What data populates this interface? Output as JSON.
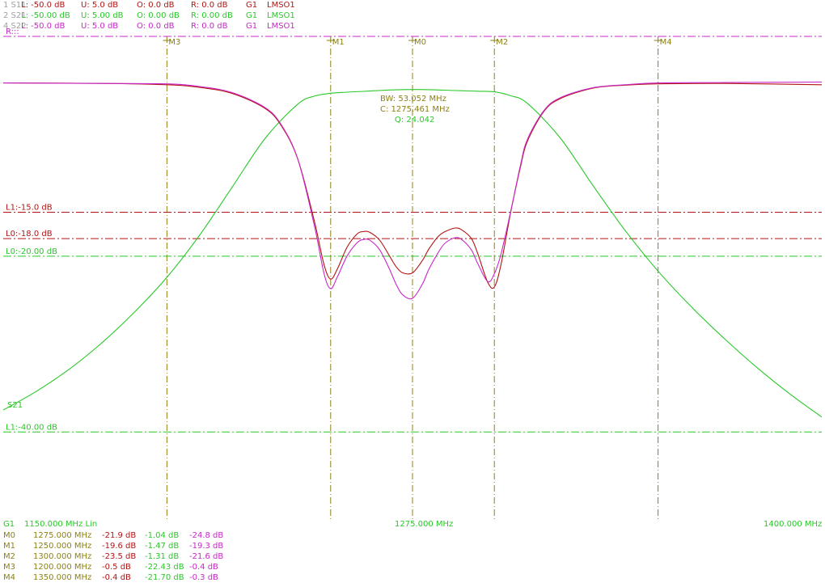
{
  "colors": {
    "s11": "#b31414",
    "s21": "#28c828",
    "s22": "#c828c8",
    "marker": "#8c8214",
    "index_gray": "#a0a0a0"
  },
  "traces": [
    {
      "index": "1 S11",
      "L": "L: -50.0 dB",
      "U": "U:  5.0 dB",
      "O": "O:  0.0 dB",
      "R": "R:  0.0 dB",
      "G": "G1",
      "mode": "LMSO1",
      "color": "#b31414"
    },
    {
      "index": "2 S21",
      "L": "L: -50.00 dB",
      "U": "U:  5.00 dB",
      "O": "O:  0.00 dB",
      "R": "R:  0.00 dB",
      "G": "G1",
      "mode": "LMSO1",
      "color": "#28c828"
    },
    {
      "index": "4 S22",
      "L": "L: -50.0 dB",
      "U": "U:  5.0 dB",
      "O": "O:  0.0 dB",
      "R": "R:  0.0 dB",
      "G": "G1",
      "mode": "LMSO1",
      "color": "#c828c8"
    }
  ],
  "axis": {
    "g1_label": "G1",
    "start": "1150.000 MHz Lin",
    "center": "1275.000 MHz",
    "stop": "1400.000 MHz"
  },
  "markers_table": [
    {
      "name": "M0",
      "freq": "1275.000 MHz",
      "s11": "-21.9 dB",
      "s21": "-1.04 dB",
      "s22": "-24.8 dB"
    },
    {
      "name": "M1",
      "freq": "1250.000 MHz",
      "s11": "-19.6 dB",
      "s21": "-1.47 dB",
      "s22": "-19.3 dB"
    },
    {
      "name": "M2",
      "freq": "1300.000 MHz",
      "s11": "-23.5 dB",
      "s21": "-1.31 dB",
      "s22": "-21.6 dB"
    },
    {
      "name": "M3",
      "freq": "1200.000 MHz",
      "s11": "-0.5 dB",
      "s21": "-22.43 dB",
      "s22": "-0.4 dB"
    },
    {
      "name": "M4",
      "freq": "1350.000 MHz",
      "s11": "-0.4 dB",
      "s21": "-21.70 dB",
      "s22": "-0.3 dB"
    }
  ],
  "chart_data": {
    "type": "line",
    "xlim": [
      1150,
      1400
    ],
    "ylim": [
      -50,
      5
    ],
    "x_unit": "MHz",
    "y_unit": "dB",
    "grid": false,
    "markers": [
      {
        "name": "M3",
        "x": 1200
      },
      {
        "name": "M1",
        "x": 1250
      },
      {
        "name": "M0",
        "x": 1275
      },
      {
        "name": "M2",
        "x": 1300
      },
      {
        "name": "M4",
        "x": 1350
      }
    ],
    "limit_lines": [
      {
        "label": "R:::",
        "y": 5,
        "color": "#c828c8"
      },
      {
        "label": "L1:-15.0 dB",
        "y": -15,
        "color": "#b31414"
      },
      {
        "label": "L0:-18.0 dB",
        "y": -18,
        "color": "#b31414"
      },
      {
        "label": "L0:-20.00 dB",
        "y": -20,
        "color": "#28c828"
      },
      {
        "label": "L1:-40.00 dB",
        "y": -40,
        "color": "#28c828"
      }
    ],
    "annotation": {
      "bw": "BW:  53.052 MHz",
      "c": "C: 1275.461 MHz",
      "q": "Q: 24.042"
    },
    "series": [
      {
        "name": "S21",
        "color": "#28c828",
        "x": [
          1150,
          1160,
          1170,
          1180,
          1190,
          1200,
          1210,
          1220,
          1230,
          1240,
          1245,
          1250,
          1255,
          1260,
          1265,
          1270,
          1275,
          1280,
          1285,
          1290,
          1295,
          1300,
          1305,
          1310,
          1320,
          1330,
          1340,
          1350,
          1360,
          1370,
          1380,
          1390,
          1400
        ],
        "y": [
          -37.5,
          -35.4,
          -32.9,
          -29.9,
          -26.4,
          -22.4,
          -17.6,
          -12.1,
          -6.6,
          -2.7,
          -1.8,
          -1.47,
          -1.35,
          -1.25,
          -1.15,
          -1.08,
          -1.04,
          -1.06,
          -1.12,
          -1.18,
          -1.24,
          -1.31,
          -1.75,
          -2.6,
          -6.5,
          -11.9,
          -17.1,
          -21.7,
          -25.7,
          -29.3,
          -32.6,
          -35.6,
          -38.3
        ]
      },
      {
        "name": "S11",
        "color": "#b31414",
        "x": [
          1150,
          1180,
          1200,
          1210,
          1220,
          1230,
          1235,
          1240,
          1245,
          1248,
          1250,
          1252,
          1255,
          1258,
          1260,
          1262,
          1265,
          1268,
          1270,
          1272,
          1275,
          1278,
          1280,
          1283,
          1285,
          1288,
          1290,
          1293,
          1295,
          1298,
          1300,
          1302,
          1305,
          1308,
          1310,
          1315,
          1320,
          1330,
          1340,
          1350,
          1370,
          1400
        ],
        "y": [
          -0.3,
          -0.35,
          -0.5,
          -0.8,
          -1.5,
          -3.2,
          -5.2,
          -9.0,
          -16.0,
          -21.0,
          -22.6,
          -21.5,
          -19.0,
          -17.5,
          -17.2,
          -17.3,
          -18.2,
          -20.0,
          -21.2,
          -21.9,
          -21.9,
          -20.5,
          -19.2,
          -17.7,
          -17.2,
          -16.8,
          -17.0,
          -18.0,
          -19.8,
          -23.0,
          -23.5,
          -21.0,
          -15.0,
          -9.8,
          -7.0,
          -3.6,
          -2.1,
          -0.9,
          -0.55,
          -0.4,
          -0.35,
          -0.5
        ]
      },
      {
        "name": "S22",
        "color": "#c828c8",
        "x": [
          1150,
          1180,
          1200,
          1210,
          1220,
          1230,
          1235,
          1240,
          1245,
          1248,
          1250,
          1252,
          1255,
          1258,
          1260,
          1262,
          1265,
          1268,
          1270,
          1272,
          1275,
          1278,
          1280,
          1283,
          1285,
          1288,
          1290,
          1293,
          1295,
          1298,
          1300,
          1302,
          1305,
          1308,
          1310,
          1315,
          1320,
          1330,
          1340,
          1350,
          1370,
          1400
        ],
        "y": [
          -0.3,
          -0.35,
          -0.4,
          -0.7,
          -1.4,
          -3.1,
          -5.1,
          -9.0,
          -16.5,
          -22.0,
          -23.7,
          -22.4,
          -20.0,
          -18.5,
          -18.1,
          -18.2,
          -19.3,
          -21.5,
          -23.2,
          -24.4,
          -24.8,
          -23.2,
          -21.5,
          -19.5,
          -18.5,
          -17.9,
          -18.1,
          -19.3,
          -20.9,
          -22.9,
          -22.0,
          -19.8,
          -14.9,
          -9.6,
          -6.8,
          -3.5,
          -2.0,
          -0.85,
          -0.5,
          -0.3,
          -0.25,
          -0.2
        ]
      }
    ],
    "series_labels": [
      {
        "name": "S21",
        "color": "#28c828"
      }
    ]
  }
}
